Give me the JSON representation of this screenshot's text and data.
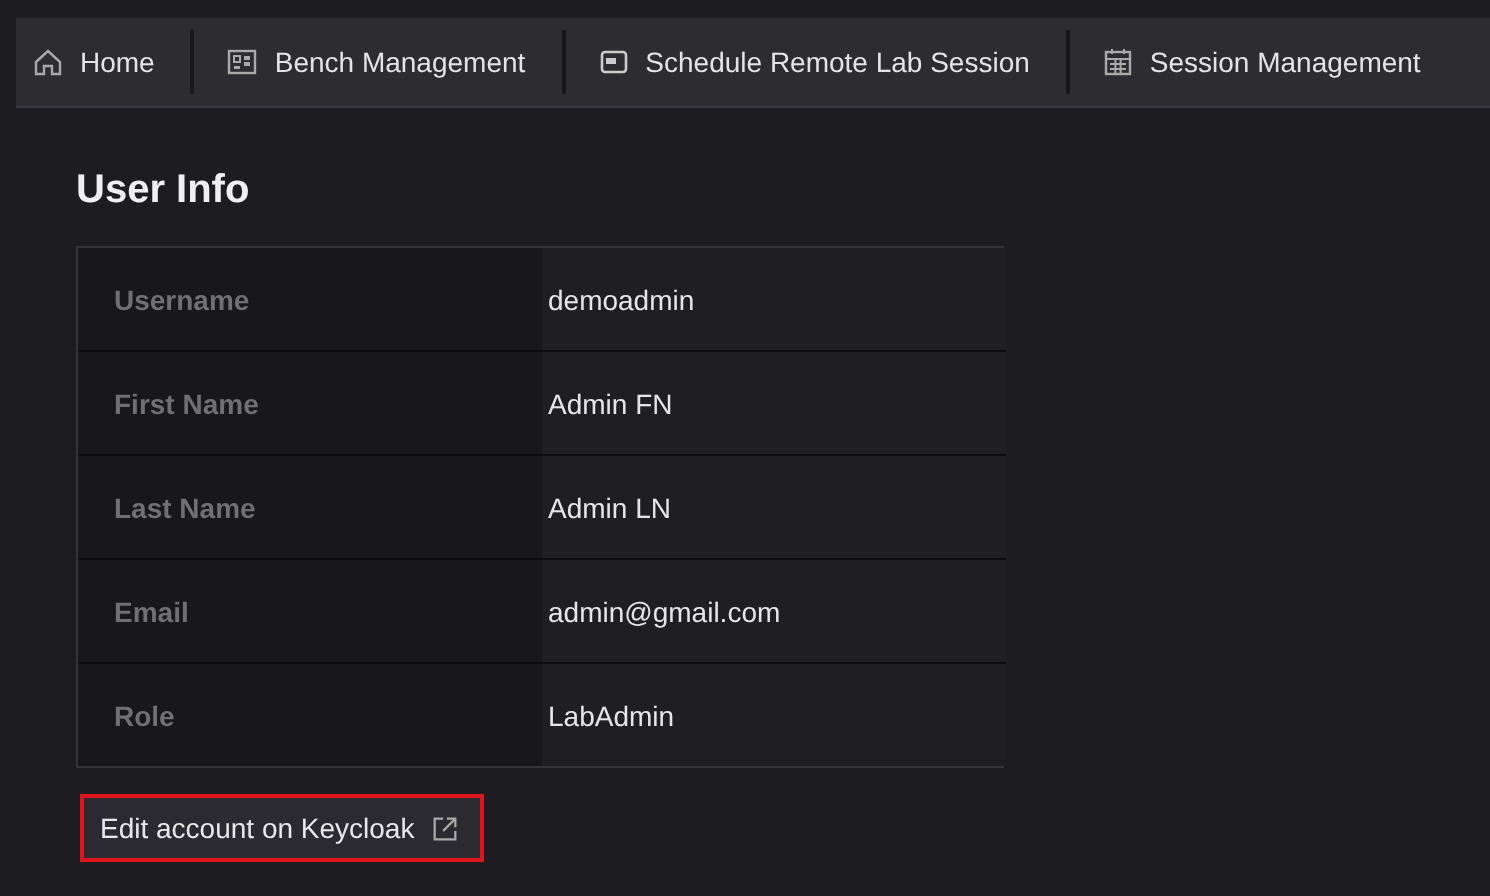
{
  "nav": [
    {
      "label": "Home"
    },
    {
      "label": "Bench Management"
    },
    {
      "label": "Schedule Remote Lab Session"
    },
    {
      "label": "Session Management"
    }
  ],
  "title": "User Info",
  "rows": [
    {
      "label": "Username",
      "value": "demoadmin"
    },
    {
      "label": "First Name",
      "value": "Admin FN"
    },
    {
      "label": "Last Name",
      "value": "Admin LN"
    },
    {
      "label": "Email",
      "value": "admin@gmail.com"
    },
    {
      "label": "Role",
      "value": "LabAdmin"
    }
  ],
  "edit_button": {
    "label": "Edit account on Keycloak",
    "highlighted": true
  }
}
